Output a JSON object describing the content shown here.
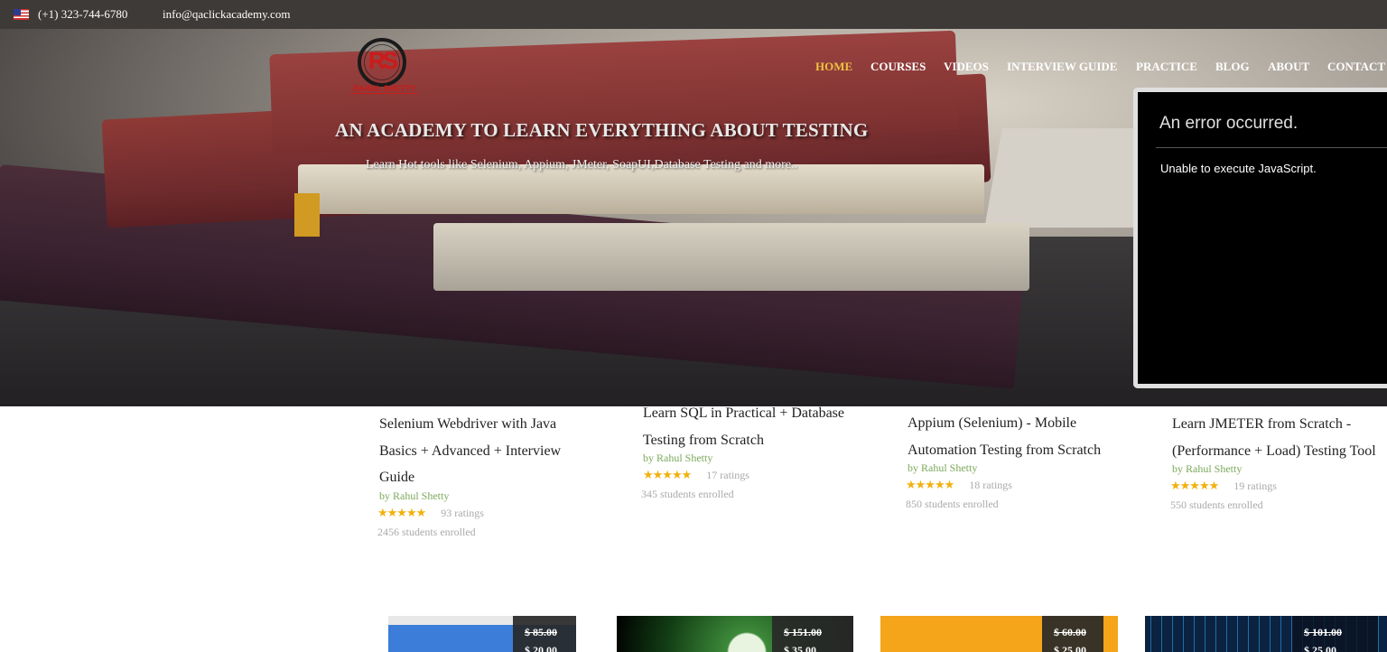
{
  "topbar": {
    "phone": "(+1) 323-744-6780",
    "email": "info@qaclickacademy.com"
  },
  "logo": {
    "mark": "RS",
    "text": "RAHUL SHETTY"
  },
  "nav": [
    {
      "label": "HOME",
      "active": true
    },
    {
      "label": "COURSES"
    },
    {
      "label": "VIDEOS"
    },
    {
      "label": "INTERVIEW GUIDE"
    },
    {
      "label": "PRACTICE"
    },
    {
      "label": "BLOG"
    },
    {
      "label": "ABOUT"
    },
    {
      "label": "CONTACT"
    }
  ],
  "hero": {
    "title": "AN ACADEMY TO LEARN EVERYTHING ABOUT TESTING",
    "subtitle": "Learn Hot tools like Selenium, Appium, JMeter, SoapUI,Database Testing and more.."
  },
  "error": {
    "title": "An error occurred.",
    "message": "Unable to execute JavaScript."
  },
  "courses": [
    {
      "title": "Selenium Webdriver with Java Basics + Advanced + Interview Guide",
      "author": "by Rahul Shetty",
      "stars": "★★★★★",
      "ratings": "93 ratings",
      "enrolled": "2456 students enrolled"
    },
    {
      "title": "Learn SQL in Practical + Database Testing from Scratch",
      "author": "by Rahul Shetty",
      "stars": "★★★★★",
      "ratings": "17 ratings",
      "enrolled": "345 students enrolled"
    },
    {
      "title": "Appium (Selenium) - Mobile Automation Testing from Scratch",
      "author": "by Rahul Shetty",
      "stars": "★★★★★",
      "ratings": "18 ratings",
      "enrolled": "850 students enrolled"
    },
    {
      "title": "Learn JMETER from Scratch - (Performance + Load) Testing Tool",
      "author": "by Rahul Shetty",
      "stars": "★★★★★",
      "ratings": "19 ratings",
      "enrolled": "550 students enrolled"
    }
  ],
  "thumbs": [
    {
      "old_price": "$ 85.00",
      "new_price": "$ 20.00",
      "color": "#4a90d9"
    },
    {
      "old_price": "$ 151.00",
      "new_price": "$ 35.00",
      "color": "#3d8a3a"
    },
    {
      "old_price": "$ 60.00",
      "new_price": "$ 25.00",
      "color": "#f4a51a"
    },
    {
      "old_price": "$ 101.00",
      "new_price": "$ 25.00",
      "color": "#0b2240"
    }
  ]
}
